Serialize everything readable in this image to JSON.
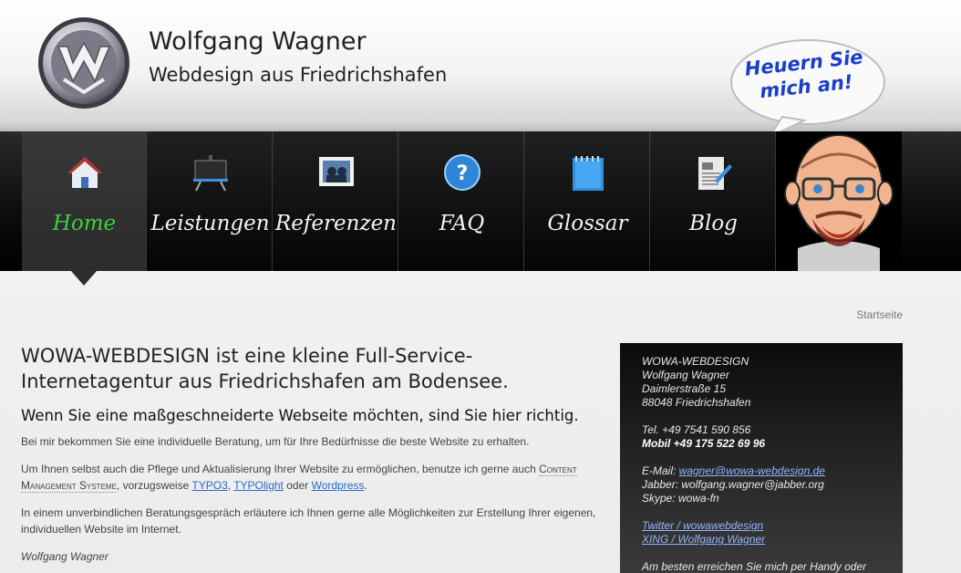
{
  "header": {
    "title": "Wolfgang Wagner",
    "subtitle": "Webdesign aus Friedrichshafen",
    "bubble_text": "Heuern Sie mich an!"
  },
  "nav": {
    "items": [
      {
        "label": "Home",
        "icon": "home-icon",
        "active": true
      },
      {
        "label": "Leistungen",
        "icon": "easel-icon"
      },
      {
        "label": "Referenzen",
        "icon": "photo-icon"
      },
      {
        "label": "FAQ",
        "icon": "help-icon"
      },
      {
        "label": "Glossar",
        "icon": "notepad-icon"
      },
      {
        "label": "Blog",
        "icon": "blog-icon"
      }
    ]
  },
  "breadcrumb": "Startseite",
  "main": {
    "heading": "WOWA-WEBDESIGN ist eine kleine Full-Service-Internetagentur aus Friedrichshafen am Bodensee.",
    "subheading": "Wenn Sie eine maßgeschneiderte Webseite möchten, sind Sie hier richtig.",
    "p1": "Bei mir bekommen Sie eine individuelle Beratung, um für Ihre Bedürfnisse die beste Website zu erhalten.",
    "p2_a": "Um Ihnen selbst auch die Pflege und Aktualisierung Ihrer Website zu ermöglichen, benutze ich gerne auch ",
    "p2_cms": "Content Management Systeme",
    "p2_b": ", vorzugsweise ",
    "p2_link1": "TYPO3",
    "p2_c": ", ",
    "p2_link2": "TYPOlight",
    "p2_d": " oder ",
    "p2_link3": "Wordpress",
    "p2_e": ".",
    "p3": "In einem unverbindlichen Beratungsgespräch erläutere ich Ihnen gerne alle Möglichkeiten zur Erstellung Ihrer eigenen, individuellen Website im Internet.",
    "signature": "Wolfgang Wagner"
  },
  "sidebar": {
    "company": "WOWA-WEBDESIGN",
    "name": "Wolfgang Wagner",
    "street": "Daimlerstraße 15",
    "city": "88048 Friedrichshafen",
    "tel": "Tel. +49 7541 590 856",
    "mobil": "Mobil +49 175 522 69 96",
    "email_label": "E-Mail: ",
    "email": "wagner@wowa-webdesign.de",
    "jabber": "Jabber: wolfgang.wagner@jabber.org",
    "skype": "Skype: wowa-fn",
    "twitter": "Twitter / wowawebdesign",
    "xing": "XING / Wolfgang Wagner",
    "note": "Am besten erreichen Sie mich per Handy oder"
  },
  "colors": {
    "active_nav": "#37d43a",
    "bubble_text": "#1a3fc9",
    "link": "#2a6ac9"
  }
}
